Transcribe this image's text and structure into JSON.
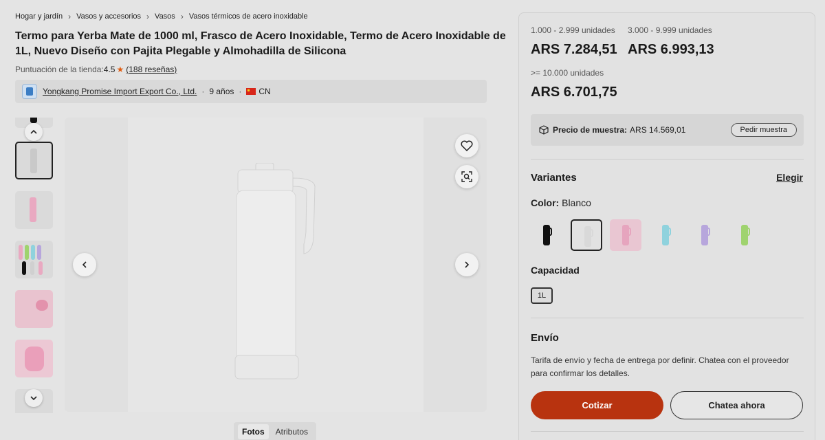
{
  "breadcrumb": [
    "Hogar y jardín",
    "Vasos y accesorios",
    "Vasos",
    "Vasos térmicos de acero inoxidable"
  ],
  "product": {
    "title": "Termo para Yerba Mate de 1000 ml, Frasco de Acero Inoxidable, Termo de Acero Inoxidable de 1L, Nuevo Diseño con Pajita Plegable y Almohadilla de Silicona"
  },
  "rating": {
    "label": "Puntuación de la tienda:",
    "score": "4.5",
    "reviews": "(188 reseñas)"
  },
  "supplier": {
    "name": "Yongkang Promise Import Export Co., Ltd.",
    "years": "9 años",
    "country": "CN"
  },
  "gallery": {
    "tabs": [
      "Fotos",
      "Atributos"
    ],
    "active_tab": "Fotos",
    "thumb_count": 6,
    "selected_thumb": 1
  },
  "pricing": {
    "tiers": [
      {
        "qty": "1.000 - 2.999 unidades",
        "price": "ARS 7.284,51"
      },
      {
        "qty": "3.000 - 9.999 unidades",
        "price": "ARS 6.993,13"
      },
      {
        "qty": ">= 10.000 unidades",
        "price": "ARS 6.701,75"
      }
    ]
  },
  "sample": {
    "label": "Precio de muestra:",
    "price": "ARS 14.569,01",
    "button": "Pedir muestra"
  },
  "variants": {
    "title": "Variantes",
    "choose": "Elegir",
    "color_label": "Color:",
    "color_value": "Blanco",
    "colors": [
      {
        "name": "Negro",
        "hex": "#111111"
      },
      {
        "name": "Blanco",
        "hex": "#d9d9d9"
      },
      {
        "name": "Rosa",
        "hex": "#e6a5be"
      },
      {
        "name": "Celeste",
        "hex": "#8fd2dd"
      },
      {
        "name": "Lila",
        "hex": "#b7a6dc"
      },
      {
        "name": "Verde",
        "hex": "#9fd36e"
      }
    ],
    "selected_color": 1,
    "capacity_title": "Capacidad",
    "capacity_value": "1L"
  },
  "shipping": {
    "title": "Envío",
    "text": "Tarifa de envío y fecha de entrega por definir. Chatea con el proveedor para confirmar los detalles."
  },
  "actions": {
    "quote": "Cotizar",
    "chat": "Chatea ahora"
  },
  "colors": {
    "accent": "#b8330f",
    "star": "#e05d12"
  }
}
